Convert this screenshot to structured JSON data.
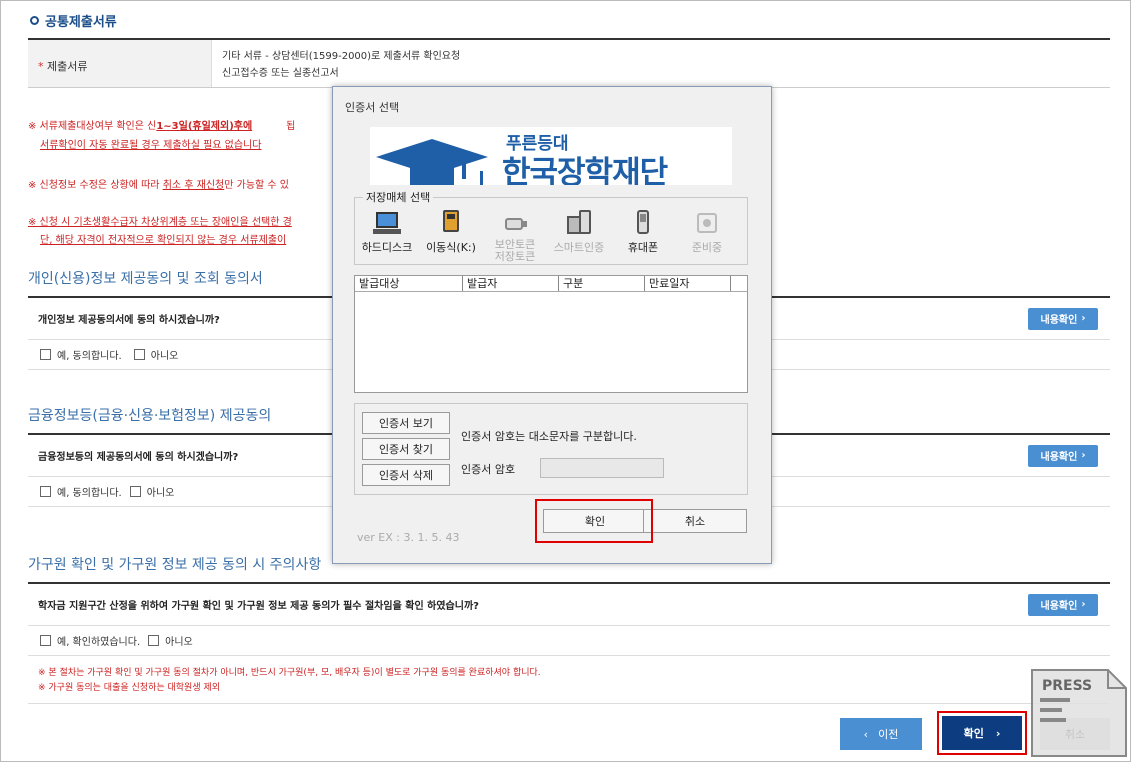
{
  "section": {
    "title": "공통제출서류"
  },
  "doc_table": {
    "header": "제출서류",
    "line1": "기타 서류 - 상담센터(1599-2000)로 제출서류 확인요청",
    "line2": "신고접수증 또는 실종선고서"
  },
  "notices": [
    {
      "a": "※ 서류제출대상여부 확인은 신",
      "b": "1~3일(휴일제외)후에",
      "c": "됩"
    },
    {
      "a": "서류확인이 자동 완료될 경우 제출하실 필요 없습니다"
    },
    {
      "a": "※ 신청정보 수정은 상황에 따라 ",
      "b": "취소 후 재신청",
      "c": "만 가능할 수 있"
    },
    {
      "a": "※ 신청 시 기초생활수급자 차상위계층 또는 장애인을 선택한 경"
    },
    {
      "a": "단, 해당 자격이 전자적으로 확인되지 않는 경우 서류제출이"
    }
  ],
  "consent1": {
    "title": "개인(신용)정보 제공동의 및 조회 동의서",
    "question": "개인정보 제공동의서에 동의 하시겠습니까?",
    "yes": "예, 동의합니다.",
    "no": "아니오",
    "button": "내용확인"
  },
  "consent2": {
    "title": "금융정보등(금융·신용·보험정보) 제공동의",
    "question": "금융정보등의 제공동의서에 동의 하시겠습니까?",
    "yes": "예, 동의합니다.",
    "no": "아니오",
    "button": "내용확인"
  },
  "consent3": {
    "title": "가구원 확인 및 가구원 정보 제공 동의 시 주의사항",
    "question": "학자금 지원구간 산정을 위하여 가구원 확인 및 가구원 정보 제공 동의가 필수 절차임을 확인 하였습니까?",
    "yes": "예, 확인하였습니다.",
    "no": "아니오",
    "button": "내용확인"
  },
  "bottom_notice": {
    "line1": "※ 본 절차는 가구원 확인 및 가구원 동의 절차가 아니며, 반드시 가구원(부, 모, 배우자 등)이 별도로 가구원 동의를 완료하셔야 합니다.",
    "line2": "※ 가구원 동의는 대출을 신청하는 대학원생 제외"
  },
  "nav": {
    "prev": "이전",
    "confirm": "확인",
    "cancel": "취소"
  },
  "dialog": {
    "title": "인증서 선택",
    "banner_small": "푸른등대",
    "banner_big": "한국장학재단",
    "media_label": "저장매체 선택",
    "media": [
      {
        "label": "하드디스크",
        "icon": "laptop-icon"
      },
      {
        "label": "이동식(K:)",
        "icon": "usb-drive-icon"
      },
      {
        "label": "보안토큰",
        "label2": "저장토큰",
        "icon": "token-icon"
      },
      {
        "label": "스마트인증",
        "icon": "smart-cert-icon"
      },
      {
        "label": "휴대폰",
        "icon": "phone-icon"
      },
      {
        "label": "준비중",
        "icon": "pending-icon"
      }
    ],
    "columns": [
      "발급대상",
      "발급자",
      "구분",
      "만료일자"
    ],
    "btn_view": "인증서 보기",
    "btn_find": "인증서 찾기",
    "btn_delete": "인증서 삭제",
    "case_note": "인증서 암호는 대소문자를 구분합니다.",
    "pw_label": "인증서 암호",
    "ok": "확인",
    "cancel": "취소",
    "version": "ver EX : 3. 1. 5. 43"
  },
  "watermark": {
    "text": "PRESS"
  },
  "colors": {
    "accent_blue": "#4a8fd2",
    "nav_dark": "#0d3d80",
    "highlight_red": "#e00000",
    "notice_red": "#cc2222"
  }
}
